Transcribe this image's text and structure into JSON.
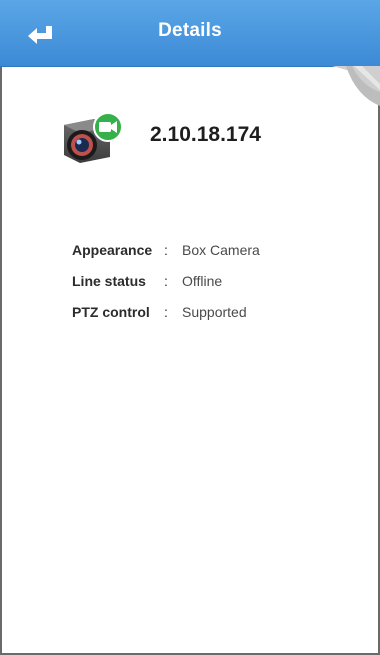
{
  "header": {
    "title": "Details",
    "back_icon": "back-arrow-icon"
  },
  "device": {
    "icon": "camera-icon",
    "ip_text": "2.10.18.174"
  },
  "details": [
    {
      "label": "Appearance",
      "colon": ":",
      "value": "Box Camera"
    },
    {
      "label": "Line status",
      "colon": ":",
      "value": "Offline"
    },
    {
      "label": "PTZ control",
      "colon": ":",
      "value": "Supported"
    }
  ],
  "colors": {
    "header_top": "#5aa6e6",
    "header_bottom": "#3c8ad6",
    "badge_green": "#35b04a"
  }
}
